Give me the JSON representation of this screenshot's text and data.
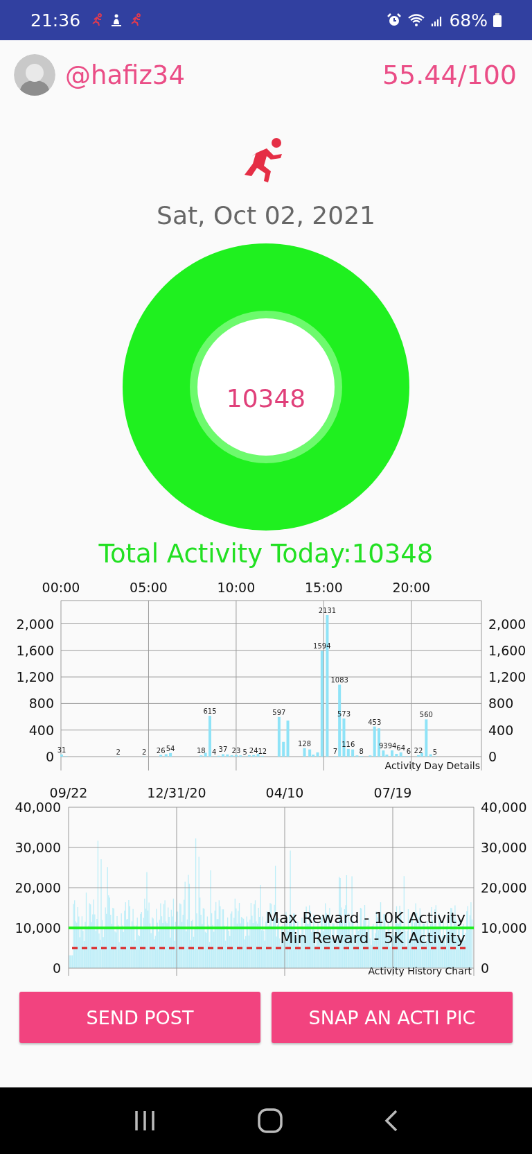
{
  "status_bar": {
    "time": "21:36",
    "battery": "68%"
  },
  "header": {
    "username": "@hafiz34",
    "score": "55.44/100"
  },
  "date": "Sat, Oct 02, 2021",
  "ring": {
    "value": "10348"
  },
  "total": "Total Activity Today:10348",
  "day_chart": {
    "chart_data": {
      "type": "bar",
      "title": "Activity Day Details",
      "xlim": [
        0,
        24
      ],
      "ylim": [
        0,
        2350
      ],
      "grid": true,
      "value_labels": [
        "31",
        null,
        "2",
        "2",
        "26",
        null,
        "54",
        "18",
        null,
        "615",
        "4",
        null,
        "37",
        null,
        null,
        "23",
        null,
        "5",
        null,
        "24",
        null,
        "12",
        "597",
        null,
        null,
        "128",
        null,
        null,
        null,
        "1594",
        "2131",
        "7",
        "1083",
        "573",
        "116",
        null,
        null,
        "8",
        null,
        "453",
        null,
        "93",
        null,
        "94",
        null,
        "64",
        null,
        "6",
        "22",
        null,
        "560",
        null,
        "5"
      ],
      "x": [
        0.04,
        0.3,
        3.27,
        4.75,
        5.7,
        6.0,
        6.25,
        8.0,
        8.25,
        8.5,
        8.75,
        9.0,
        9.25,
        9.5,
        9.75,
        10.0,
        10.25,
        10.5,
        10.75,
        11.0,
        11.25,
        11.5,
        12.45,
        12.7,
        12.95,
        13.9,
        14.2,
        14.4,
        14.65,
        14.9,
        15.2,
        15.65,
        15.9,
        16.15,
        16.4,
        16.65,
        16.9,
        17.15,
        17.65,
        17.9,
        18.15,
        18.4,
        18.6,
        18.9,
        19.15,
        19.4,
        19.6,
        19.85,
        20.4,
        20.6,
        20.85,
        21.1,
        21.35
      ],
      "values": [
        31,
        6,
        2,
        2,
        26,
        37,
        54,
        18,
        57,
        615,
        4,
        13,
        37,
        33,
        19,
        23,
        18,
        5,
        22,
        24,
        40,
        12,
        597,
        222,
        543,
        128,
        108,
        29,
        64,
        1594,
        2131,
        7,
        1083,
        573,
        116,
        108,
        18,
        8,
        18,
        453,
        426,
        93,
        30,
        94,
        42,
        64,
        8,
        6,
        22,
        56,
        560,
        35,
        5
      ],
      "xticks": [
        {
          "value": 0,
          "label": "00:00"
        },
        {
          "value": 5,
          "label": "05:00"
        },
        {
          "value": 10,
          "label": "10:00"
        },
        {
          "value": 15,
          "label": "15:00"
        },
        {
          "value": 20,
          "label": "20:00"
        }
      ],
      "yticks": [
        {
          "value": 0,
          "label": "0"
        },
        {
          "value": 400,
          "label": "400"
        },
        {
          "value": 800,
          "label": "800"
        },
        {
          "value": 1200,
          "label": "1,200"
        },
        {
          "value": 1600,
          "label": "1,600"
        },
        {
          "value": 2000,
          "label": "2,000"
        }
      ]
    },
    "right_axis_labels": [
      "2,000",
      "1,600",
      "1,200",
      "800",
      "400",
      "0"
    ]
  },
  "history_chart": {
    "caption": "Activity History Chart",
    "x_labels": [
      "09/22",
      "12/31/20",
      "04/10",
      "07/19"
    ],
    "left_axis_labels": [
      "40,000",
      "30,000",
      "20,000",
      "10,000",
      "0"
    ],
    "right_axis_labels": [
      "40,000",
      "30,000",
      "20,000",
      "10,000",
      "0"
    ],
    "reward_lines": [
      {
        "label": "Max Reward - 10K Activity",
        "kind": "solid",
        "color": "#22ee22"
      },
      {
        "label": "Min Reward - 5K Activity",
        "kind": "dashed",
        "color": "#dd2222"
      }
    ]
  },
  "buttons": [
    "SEND POST",
    "SNAP AN ACTI PIC"
  ]
}
